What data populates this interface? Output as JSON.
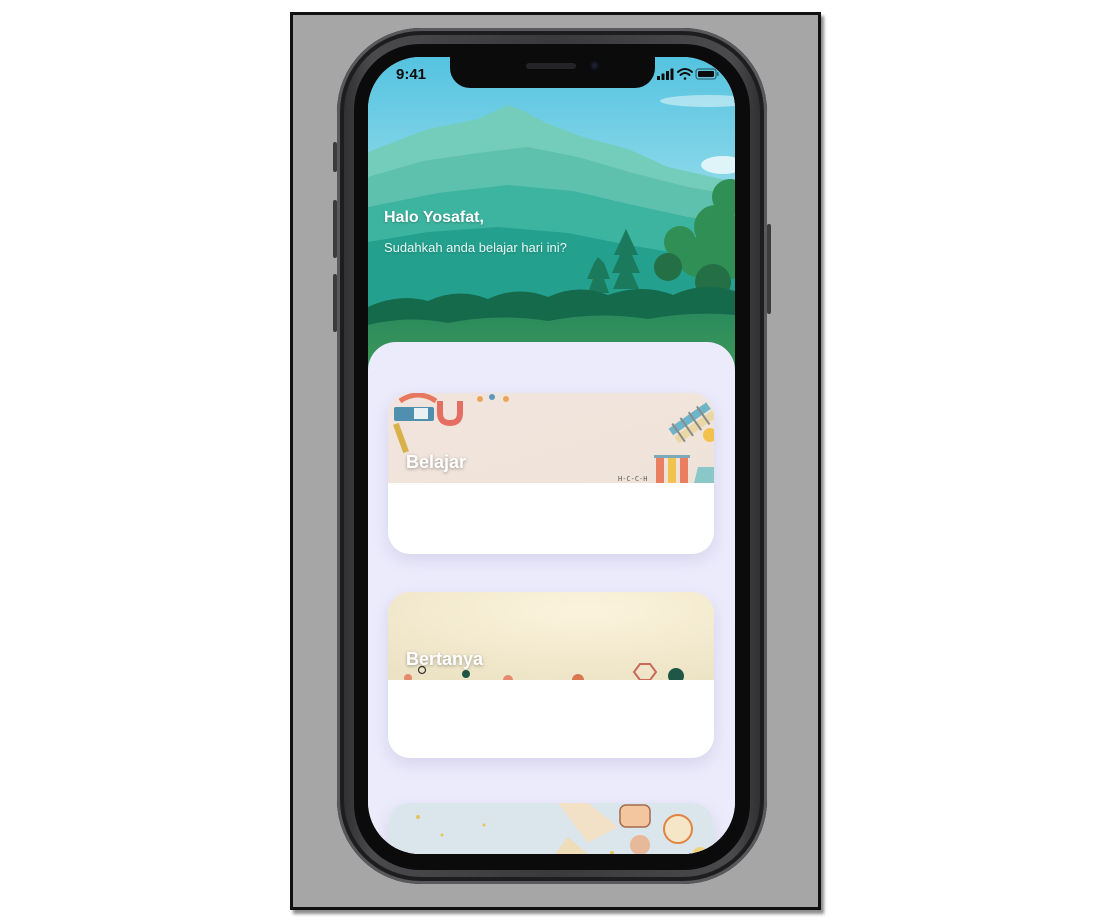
{
  "status_bar": {
    "time": "9:41"
  },
  "header": {
    "greeting": "Halo Yosafat,",
    "subtitle": "Sudahkah anda belajar hari ini?"
  },
  "cards": [
    {
      "title": "Belajar",
      "banner": "science-illustration"
    },
    {
      "title": "Bertanya",
      "banner": "chemistry-illustration"
    },
    {
      "title": "",
      "banner": "space-illustration"
    }
  ],
  "colors": {
    "sky_top": "#58c8e2",
    "mountain": "#6fcbb7",
    "forest": "#1b6f52",
    "sheet_bg": "#ecebfb",
    "card_bg": "#ffffff"
  }
}
